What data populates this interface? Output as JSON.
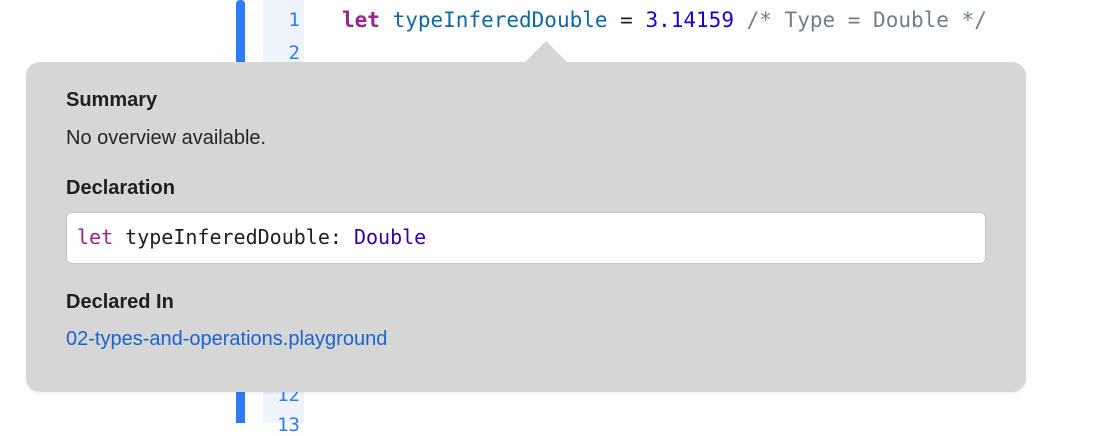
{
  "editor": {
    "line_numbers": [
      "1",
      "2",
      "12",
      "13"
    ],
    "code_line_1": {
      "keyword": "let",
      "identifier": "typeInferedDouble",
      "operator": " = ",
      "number": "3.14159",
      "comment": " /* Type = Double */"
    }
  },
  "quick_help": {
    "summary_title": "Summary",
    "summary_text": "No overview available.",
    "declaration_title": "Declaration",
    "declaration": {
      "keyword": "let",
      "name": " typeInferedDouble: ",
      "type": "Double"
    },
    "declared_in_title": "Declared In",
    "declared_in_link": "02-types-and-operations.playground"
  },
  "colors": {
    "change_bar": "#2d7cf6",
    "keyword": "#9b2393",
    "identifier": "#0f68a0",
    "number": "#1c00cf",
    "comment": "#707f8c",
    "link": "#1a64d0",
    "popover_bg": "#d6d6d6"
  }
}
